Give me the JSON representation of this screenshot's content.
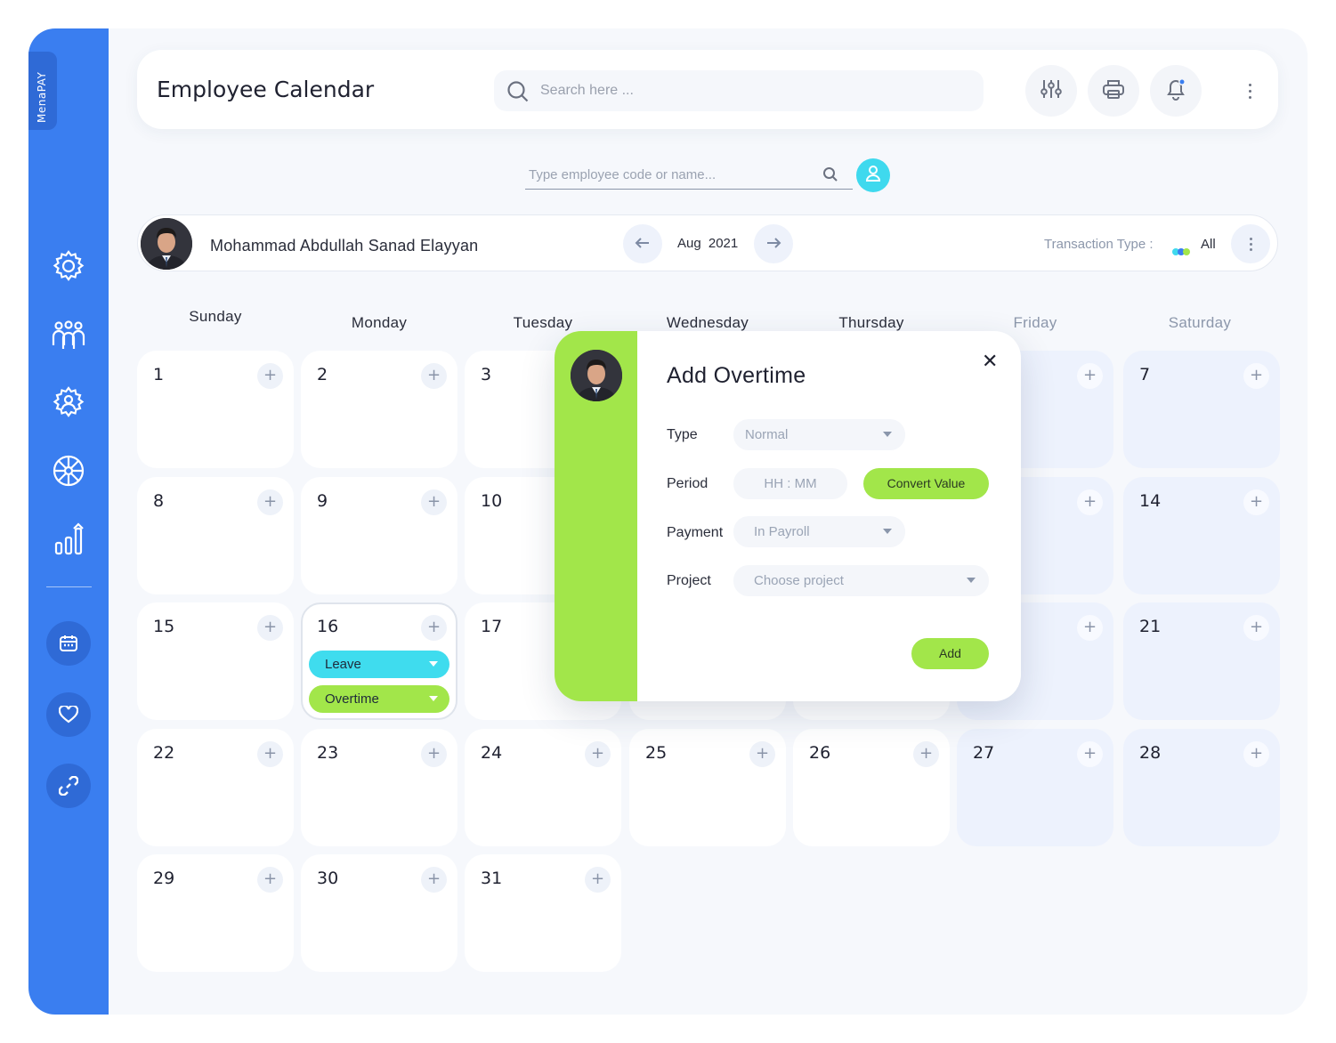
{
  "brand": "MenaPAY",
  "header": {
    "title": "Employee Calendar",
    "search_placeholder": "Search here ..."
  },
  "employee_search": {
    "placeholder": "Type employee code or name..."
  },
  "employee": {
    "name": "Mohammad Abdullah Sanad Elayyan"
  },
  "period": {
    "month": "Aug",
    "year": "2021"
  },
  "transaction": {
    "label": "Transaction Type :",
    "value": "All",
    "dot_colors": [
      "#3fd9ee",
      "#3a7ef0",
      "#a2e64a"
    ]
  },
  "days": [
    "Sunday",
    "Monday",
    "Tuesday",
    "Wednesday",
    "Thursday",
    "Friday",
    "Saturday"
  ],
  "plus_glyph": "+",
  "calendar": {
    "w1": [
      "1",
      "2",
      "3",
      "7"
    ],
    "w2": [
      "8",
      "9",
      "10",
      "14"
    ],
    "w3": [
      "15",
      "16",
      "17",
      "21"
    ],
    "w4": [
      "22",
      "23",
      "24",
      "25",
      "26",
      "27",
      "28"
    ],
    "w5": [
      "29",
      "30",
      "31"
    ]
  },
  "day16_tags": [
    {
      "label": "Leave",
      "color": "#3fdcee"
    },
    {
      "label": "Overtime",
      "color": "#a2e64a"
    }
  ],
  "modal": {
    "title": "Add Overtime",
    "close": "✕",
    "type_label": "Type",
    "type_value": "Normal",
    "period_label": "Period",
    "period_placeholder": "HH : MM",
    "convert_label": "Convert Value",
    "payment_label": "Payment",
    "payment_value": "In Payroll",
    "project_label": "Project",
    "project_placeholder": "Choose project",
    "add_label": "Add"
  },
  "colors": {
    "sidebar": "#3a7ef0",
    "accent_green": "#a2e64a",
    "accent_cyan": "#3fd9ee"
  }
}
